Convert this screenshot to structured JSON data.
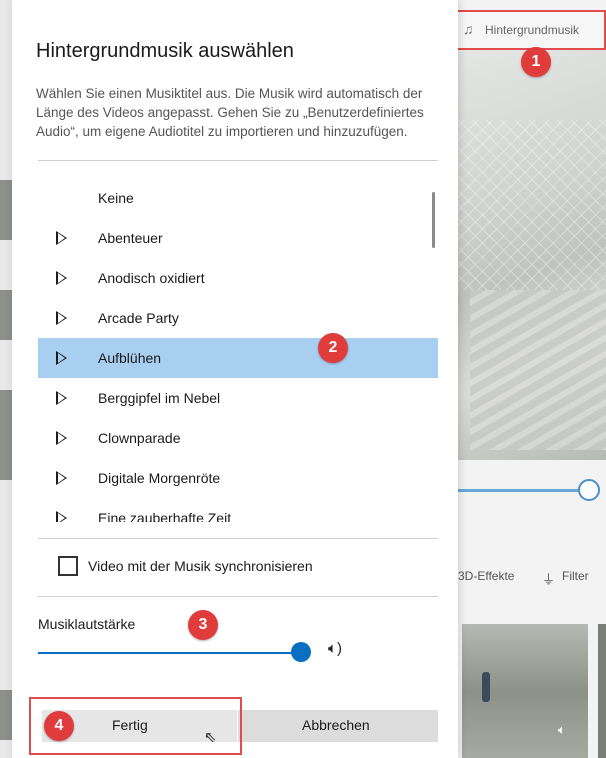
{
  "app": {
    "top_button_label": "Hintergrundmusik",
    "fx_3d_label": "3D-Effekte",
    "fx_filter_label": "Filter",
    "fx_3d_visible": "3D-Effekte"
  },
  "dialog": {
    "title": "Hintergrundmusik auswählen",
    "description": "Wählen Sie einen Musiktitel aus. Die Musik wird automatisch der Länge des Videos angepasst. Gehen Sie zu „Benutzerdefiniertes Audio“, um eigene Audiotitel zu importieren und hinzuzufügen.",
    "tracks": [
      {
        "name": "Keine",
        "play": false,
        "selected": false
      },
      {
        "name": "Abenteuer",
        "play": true,
        "selected": false
      },
      {
        "name": "Anodisch oxidiert",
        "play": true,
        "selected": false
      },
      {
        "name": "Arcade Party",
        "play": true,
        "selected": false
      },
      {
        "name": "Aufblühen",
        "play": true,
        "selected": true
      },
      {
        "name": "Berggipfel im Nebel",
        "play": true,
        "selected": false
      },
      {
        "name": "Clownparade",
        "play": true,
        "selected": false
      },
      {
        "name": "Digitale Morgenröte",
        "play": true,
        "selected": false
      },
      {
        "name": "Eine zauberhafte Zeit",
        "play": true,
        "selected": false
      }
    ],
    "sync_label": "Video mit der Musik synchronisieren",
    "sync_checked": false,
    "volume_label": "Musiklautstärke",
    "volume_level": 1.0,
    "done_label": "Fertig",
    "cancel_label": "Abbrechen"
  },
  "callouts": {
    "badge1": "1",
    "badge2": "2",
    "badge3": "3",
    "badge4": "4",
    "color": "#e03c3c"
  },
  "colors": {
    "selection": "#a9cff0",
    "accent": "#0a6fc2"
  },
  "icons": {
    "top_button": "music-note-icon",
    "filter": "filter-icon",
    "volume": "speaker-icon",
    "cursor": "mouse-pointer-icon"
  }
}
